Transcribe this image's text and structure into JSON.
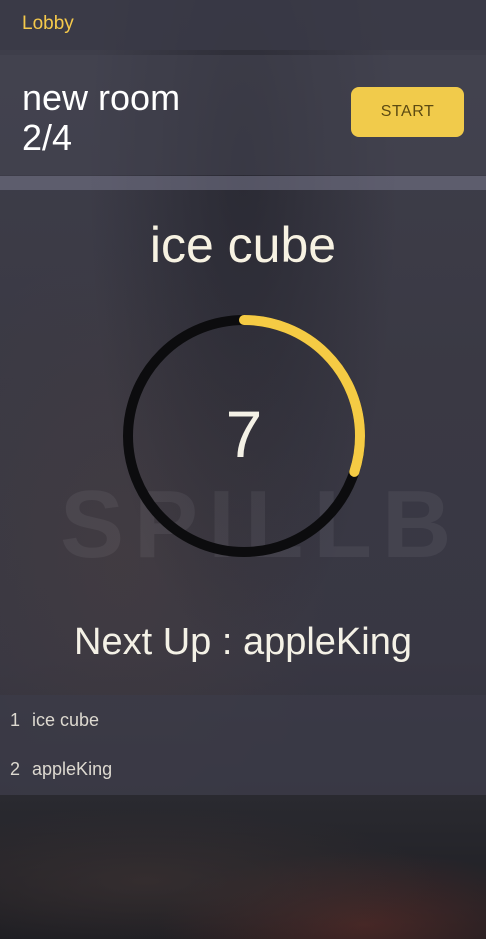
{
  "topbar": {
    "lobby_label": "Lobby"
  },
  "room": {
    "name": "new room",
    "player_count": "2/4",
    "start_label": "START"
  },
  "current_player": "ice cube",
  "timer": {
    "value": "7",
    "progress_fraction": 0.3,
    "track_color": "#0c0c0e",
    "progress_color": "#f5cb44"
  },
  "next_up": "Next Up : appleKing",
  "players": [
    {
      "index": "1",
      "name": "ice cube"
    },
    {
      "index": "2",
      "name": "appleKing"
    }
  ],
  "colors": {
    "accent": "#f1cb4b",
    "text": "#f4f1e6"
  }
}
